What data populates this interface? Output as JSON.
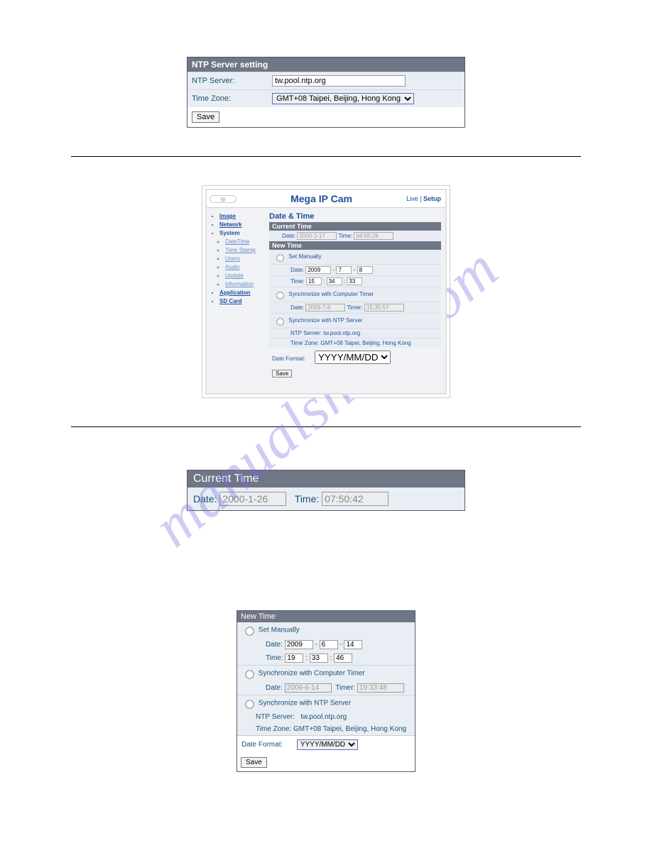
{
  "watermark": "manualshive.com",
  "panel1": {
    "header": "NTP Server setting",
    "ntp_label": "NTP Server:",
    "ntp_value": "tw.pool.ntp.org",
    "tz_label": "Time Zone:",
    "tz_value": "GMT+08 Taipei, Beijing, Hong Kong",
    "save_label": "Save"
  },
  "panel2": {
    "title": "Mega IP Cam",
    "link_live": "Live",
    "link_setup": "Setup",
    "nav": {
      "image": "Image",
      "network": "Network",
      "system": "System",
      "system_sub": [
        "DateTime",
        "Time Stamp",
        "Users",
        "Audio",
        "Update",
        "Information"
      ],
      "application": "Application",
      "sdcard": "SD Card"
    },
    "heading": "Date & Time",
    "current_header": "Current Time",
    "current_date_label": "Date:",
    "current_date_value": "2000-1-17",
    "current_time_label": "Time:",
    "current_time_value": "04:55:28",
    "new_header": "New Time",
    "set_manually": "Set Manually",
    "date_label": "Date:",
    "date_y": "2009",
    "date_m": "7",
    "date_d": "8",
    "time_label": "Time:",
    "time_h": "15",
    "time_mm": "34",
    "time_s": "33",
    "sync_comp": "Synchronize with Computer Timer",
    "sync_comp_date": "2009-7-8",
    "sync_comp_time": "15:35:57",
    "sync_ntp": "Synchronize with NTP Server",
    "ntp_server_label": "NTP Server:",
    "ntp_server_value": "tw.pool.ntp.org",
    "tz_label": "Time Zone:",
    "tz_value": "GMT+08 Taipei, Beijing, Hong Kong",
    "date_format_label": "Date Format:",
    "date_format_value": "YYYY/MM/DD",
    "save_label": "Save"
  },
  "panel3": {
    "header": "Current Time",
    "date_label": "Date:",
    "date_value": "2000-1-26",
    "time_label": "Time:",
    "time_value": "07:50:42"
  },
  "panel4": {
    "header": "New Time",
    "set_manually": "Set Manually",
    "date_label": "Date:",
    "date_y": "2009",
    "date_m": "6",
    "date_d": "14",
    "time_label": "Time:",
    "time_h": "19",
    "time_mm": "33",
    "time_s": "46",
    "sync_comp": "Synchronize with Computer Timer",
    "sync_comp_date_label": "Date:",
    "sync_comp_date": "2009-6-14",
    "sync_comp_time_label": "Timer:",
    "sync_comp_time": "19:33:48",
    "sync_ntp": "Synchronize with NTP Server",
    "ntp_server_label": "NTP Server:",
    "ntp_server_value": "tw.pool.ntp.org",
    "tz_label": "Time Zone:",
    "tz_value": "GMT+08 Taipei, Beijing, Hong Kong",
    "date_format_label": "Date Format:",
    "date_format_value": "YYYY/MM/DD",
    "save_label": "Save"
  }
}
